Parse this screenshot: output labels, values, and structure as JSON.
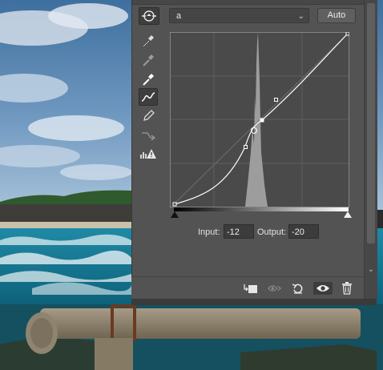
{
  "properties_panel": {
    "channel": "a",
    "auto_label": "Auto",
    "input_label": "Input:",
    "input_value": "-12",
    "output_label": "Output:",
    "output_value": "-20"
  },
  "tools": [
    {
      "name": "on-image-adjust-icon",
      "active": false
    },
    {
      "name": "black-point-eyedropper-icon",
      "active": false
    },
    {
      "name": "gray-point-eyedropper-icon",
      "active": false
    },
    {
      "name": "white-point-eyedropper-icon",
      "active": false
    },
    {
      "name": "curve-points-icon",
      "active": true
    },
    {
      "name": "pencil-draw-icon",
      "active": false
    },
    {
      "name": "smooth-curve-icon",
      "active": false
    },
    {
      "name": "clipping-warning-icon",
      "active": false
    }
  ],
  "footer_icons": [
    "clip-to-layer-icon",
    "view-previous-state-icon",
    "reset-icon",
    "visibility-eye-icon",
    "trash-icon"
  ],
  "colors": {
    "panel": "#535353",
    "graph_bg": "#4a4a4a",
    "accent_curve": "#ffffff"
  }
}
